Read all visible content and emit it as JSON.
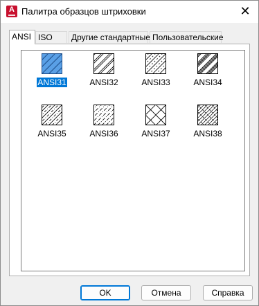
{
  "window": {
    "title": "Палитра образцов штриховки",
    "app_icon_letter": "A",
    "close_glyph": "✕"
  },
  "tabs": [
    {
      "label": "ANSI",
      "active": true
    },
    {
      "label": "ISO",
      "active": false
    },
    {
      "label": "Другие стандартные",
      "active": false
    },
    {
      "label": "Пользовательские",
      "active": false
    }
  ],
  "patterns": [
    {
      "label": "ANSI31",
      "selected": true
    },
    {
      "label": "ANSI32",
      "selected": false
    },
    {
      "label": "ANSI33",
      "selected": false
    },
    {
      "label": "ANSI34",
      "selected": false
    },
    {
      "label": "ANSI35",
      "selected": false
    },
    {
      "label": "ANSI36",
      "selected": false
    },
    {
      "label": "ANSI37",
      "selected": false
    },
    {
      "label": "ANSI38",
      "selected": false
    }
  ],
  "buttons": {
    "ok": "OK",
    "cancel": "Отмена",
    "help": "Справка"
  },
  "colors": {
    "selection": "#0078d7",
    "selected_swatch_fill": "#5aa0e6"
  }
}
